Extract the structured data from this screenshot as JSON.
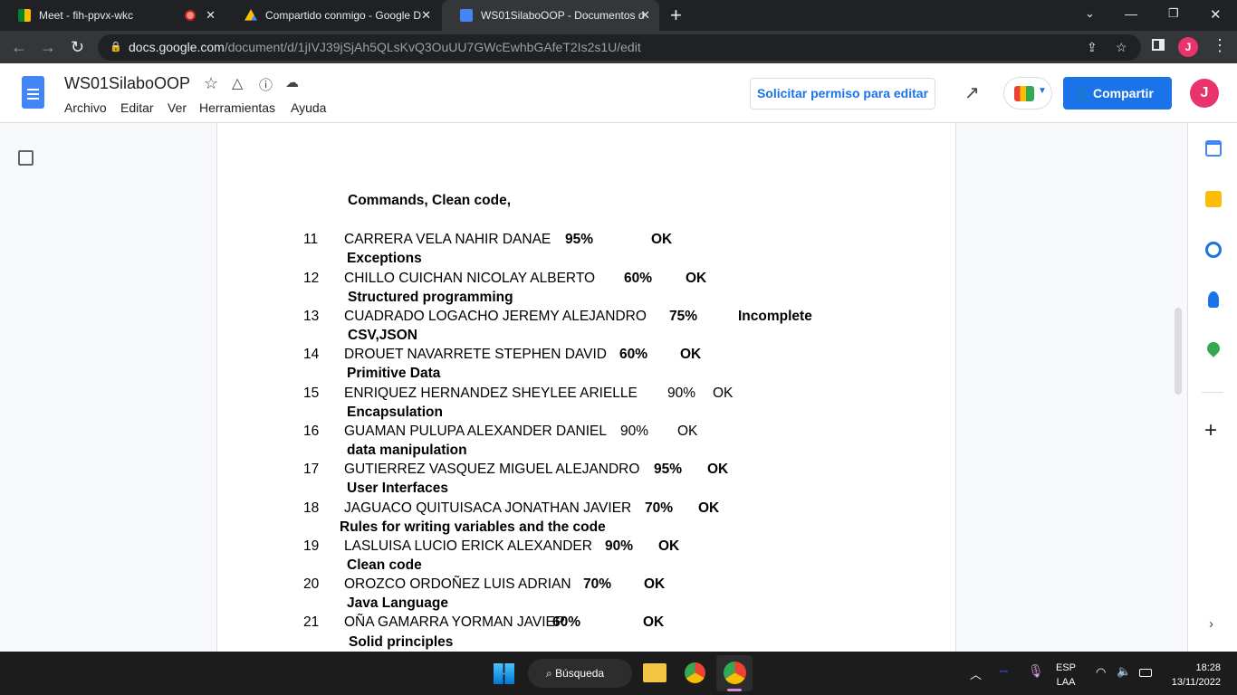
{
  "browser": {
    "tabs": [
      {
        "title": "Meet - fih-ppvx-wkc"
      },
      {
        "title": "Compartido conmigo - Google D"
      },
      {
        "title": "WS01SilaboOOP - Documentos d"
      }
    ],
    "url_domain": "docs.google.com",
    "url_path": "/document/d/1jIVJ39jSjAh5QLsKvQ3OuUU7GWcEwhbGAfeT2Is2s1U/edit"
  },
  "docs": {
    "title": "WS01SilaboOOP",
    "menus": [
      "Archivo",
      "Editar",
      "Ver",
      "Herramientas",
      "Ayuda"
    ],
    "request_edit": "Solicitar permiso para editar",
    "share": "Compartir",
    "avatar": "J"
  },
  "document": {
    "lines": [
      {
        "type": "topic",
        "text": "Commands, Clean code,"
      },
      {
        "type": "student",
        "num": "11",
        "name": "CARRERA VELA NAHIR DANAE",
        "pct": "95%",
        "status": "OK",
        "bold": true
      },
      {
        "type": "topic",
        "text": "Exceptions"
      },
      {
        "type": "student",
        "num": "12",
        "name": "CHILLO CUICHAN NICOLAY ALBERTO",
        "pct": "60%",
        "status": "OK",
        "bold": true
      },
      {
        "type": "topic",
        "text": "Structured programming"
      },
      {
        "type": "student",
        "num": "13",
        "name": "CUADRADO LOGACHO JEREMY ALEJANDRO",
        "pct": "75%",
        "status": "Incomplete",
        "bold": true
      },
      {
        "type": "topic",
        "text": "CSV,JSON"
      },
      {
        "type": "student",
        "num": "14",
        "name": "DROUET NAVARRETE STEPHEN DAVID",
        "pct": "60%",
        "status": "OK",
        "bold": true
      },
      {
        "type": "topic",
        "text": "Primitive Data"
      },
      {
        "type": "student",
        "num": "15",
        "name": "ENRIQUEZ HERNANDEZ SHEYLEE ARIELLE",
        "pct": "90%",
        "status": "OK",
        "bold": false
      },
      {
        "type": "topic",
        "text": "Encapsulation"
      },
      {
        "type": "student",
        "num": "16",
        "name": "GUAMAN PULUPA ALEXANDER DANIEL",
        "pct": "90%",
        "status": "OK",
        "bold": false
      },
      {
        "type": "topic",
        "text": "data manipulation"
      },
      {
        "type": "student",
        "num": "17",
        "name": "GUTIERREZ VASQUEZ MIGUEL ALEJANDRO",
        "pct": "95%",
        "status": "OK",
        "bold": true
      },
      {
        "type": "topic",
        "text": "User Interfaces"
      },
      {
        "type": "student",
        "num": "18",
        "name": "JAGUACO QUITUISACA JONATHAN JAVIER",
        "pct": "70%",
        "status": "OK",
        "bold": true
      },
      {
        "type": "topic",
        "text": "Rules for writing variables and the code"
      },
      {
        "type": "student",
        "num": "19",
        "name": "LASLUISA LUCIO ERICK ALEXANDER",
        "pct": "90%",
        "status": "OK",
        "bold": true
      },
      {
        "type": "topic",
        "text": "Clean code"
      },
      {
        "type": "student",
        "num": "20",
        "name": "OROZCO ORDOÑEZ LUIS ADRIAN",
        "pct": "70%",
        "status": "OK",
        "bold": true
      },
      {
        "type": "topic",
        "text": "Java Language"
      },
      {
        "type": "student",
        "num": "21",
        "name": "OÑA GAMARRA YORMAN JAVIER",
        "pct": "60%",
        "status": "OK",
        "bold": true
      },
      {
        "type": "topic",
        "text": "Solid principles"
      }
    ]
  },
  "taskbar": {
    "search": "Búsqueda",
    "lang1": "ESP",
    "lang2": "LAA",
    "time": "18:28",
    "date": "13/11/2022"
  },
  "colors": {
    "accent": "#1a73e8",
    "avatar": "#e8336b"
  }
}
